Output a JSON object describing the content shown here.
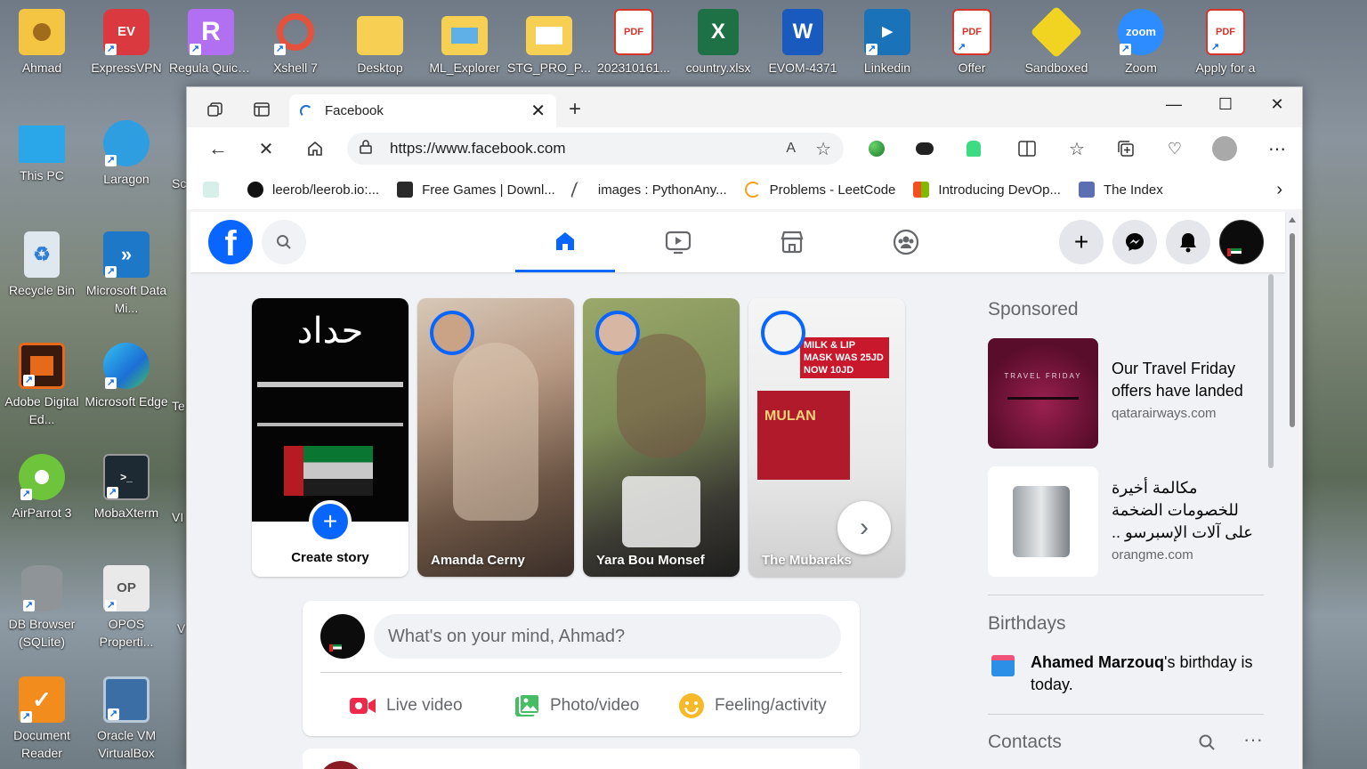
{
  "desktop": {
    "icons": [
      {
        "label": "Ahmad"
      },
      {
        "label": "ExpressVPN"
      },
      {
        "label": "Regula Quick ..."
      },
      {
        "label": "Xshell 7"
      },
      {
        "label": "Desktop"
      },
      {
        "label": "ML_Explorer"
      },
      {
        "label": "STG_PRO_P..."
      },
      {
        "label": "202310161..."
      },
      {
        "label": "country.xlsx"
      },
      {
        "label": "EVOM-4371"
      },
      {
        "label": "Linkedin"
      },
      {
        "label": "Offer"
      },
      {
        "label": "Sandboxed"
      },
      {
        "label": "Zoom"
      },
      {
        "label": "Apply for a"
      },
      {
        "label": "This PC"
      },
      {
        "label": "Laragon"
      },
      {
        "label": "Recycle Bin"
      },
      {
        "label": "Microsoft Data Mi..."
      },
      {
        "label": "Adobe Digital Ed..."
      },
      {
        "label": "Microsoft Edge"
      },
      {
        "label": "AirParrot 3"
      },
      {
        "label": "MobaXterm"
      },
      {
        "label": "DB Browser (SQLite)"
      },
      {
        "label": "OPOS Properti..."
      },
      {
        "label": "Document Reader"
      },
      {
        "label": "Oracle VM VirtualBox"
      }
    ],
    "partial_labels": [
      "Sc",
      "Te",
      "VI",
      "V"
    ]
  },
  "browser": {
    "tab_title": "Facebook",
    "url": "https://www.facebook.com",
    "bookmarks": [
      {
        "label": "leerob/leerob.io:..."
      },
      {
        "label": "Free Games | Downl..."
      },
      {
        "label": "images : PythonAny..."
      },
      {
        "label": "Problems - LeetCode"
      },
      {
        "label": "Introducing DevOp..."
      },
      {
        "label": "The Index"
      }
    ]
  },
  "facebook": {
    "stories": {
      "create_label": "Create story",
      "create_banner_text": "حداد",
      "items": [
        {
          "name": "Amanda Cerny"
        },
        {
          "name": "Yara Bou Monsef"
        },
        {
          "name": "The Mubaraks"
        }
      ],
      "mubaraks_promo": "MILK & LIP MASK WAS 25JD NOW 10JD",
      "mubaraks_product": "MULAN"
    },
    "composer": {
      "placeholder": "What's on your mind, Ahmad?",
      "actions": [
        "Live video",
        "Photo/video",
        "Feeling/activity"
      ]
    },
    "sidebar": {
      "sponsored_heading": "Sponsored",
      "ads": [
        {
          "title": "Our Travel Friday offers have landed",
          "domain": "qatarairways.com",
          "thumb_text": "TRAVEL FRIDAY"
        },
        {
          "title": "مكالمة أخيرة للخصومات الضخمة على آلات الإسبرسو ..",
          "domain": "orangme.com"
        }
      ],
      "birthdays_heading": "Birthdays",
      "birthday_name": "Ahamed Marzouq",
      "birthday_rest": "'s birthday is today.",
      "contacts_heading": "Contacts"
    }
  },
  "colors": {
    "fb_blue": "#0866ff",
    "live_red": "#f02849",
    "photo_green": "#45bd62",
    "feeling_yellow": "#f7b928"
  }
}
